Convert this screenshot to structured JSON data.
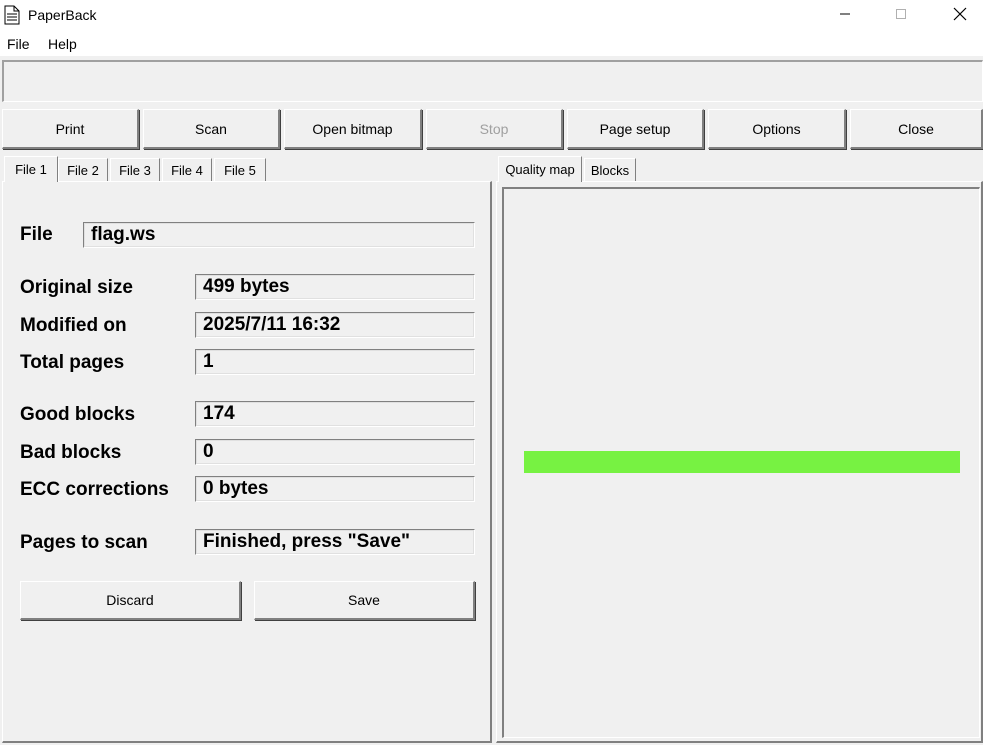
{
  "window": {
    "title": "PaperBack",
    "icon": "document-icon"
  },
  "menu": {
    "items": [
      "File",
      "Help"
    ]
  },
  "status": {
    "text": ""
  },
  "toolbar": {
    "buttons": [
      {
        "label": "Print",
        "enabled": true
      },
      {
        "label": "Scan",
        "enabled": true
      },
      {
        "label": "Open bitmap",
        "enabled": true
      },
      {
        "label": "Stop",
        "enabled": false
      },
      {
        "label": "Page setup",
        "enabled": true
      },
      {
        "label": "Options",
        "enabled": true
      },
      {
        "label": "Close",
        "enabled": true
      }
    ]
  },
  "left_tabs": {
    "active": "File 1",
    "items": [
      "File 1",
      "File 2",
      "File 3",
      "File 4",
      "File 5"
    ]
  },
  "file_info": {
    "file_label": "File",
    "file_value": "flag.ws",
    "original_size_label": "Original size",
    "original_size_value": "499 bytes",
    "modified_on_label": "Modified on",
    "modified_on_value": "2025/7/11 16:32",
    "total_pages_label": "Total pages",
    "total_pages_value": "1",
    "good_blocks_label": "Good blocks",
    "good_blocks_value": "174",
    "bad_blocks_label": "Bad blocks",
    "bad_blocks_value": "0",
    "ecc_label": "ECC corrections",
    "ecc_value": "0 bytes",
    "pages_to_scan_label": "Pages to scan",
    "pages_to_scan_value": "Finished, press \"Save\""
  },
  "panel_buttons": {
    "discard": "Discard",
    "save": "Save"
  },
  "right_tabs": {
    "active": "Quality map",
    "items": [
      "Quality map",
      "Blocks"
    ]
  },
  "quality_map": {
    "bar_color": "#77f242"
  },
  "colors": {
    "window_bg": "#f0f0f0",
    "titlebar_bg": "#ffffff",
    "disabled_text": "#a0a0a0"
  }
}
